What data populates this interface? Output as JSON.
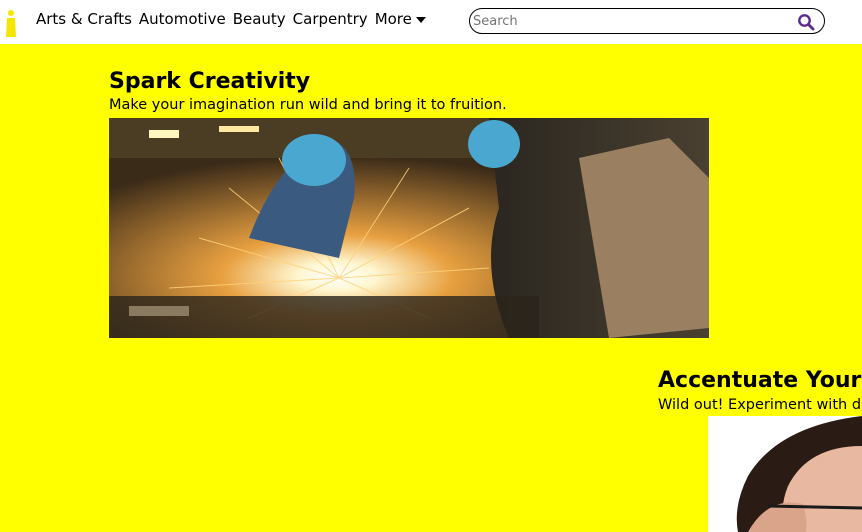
{
  "nav": {
    "items": [
      {
        "label": "Arts & Crafts"
      },
      {
        "label": "Automotive"
      },
      {
        "label": "Beauty"
      },
      {
        "label": "Carpentry"
      }
    ],
    "more_label": "More"
  },
  "search": {
    "placeholder": "Search",
    "icon": "search-icon"
  },
  "colors": {
    "background": "#ffff00",
    "header": "#ffffff",
    "logo": "#f5e600",
    "search_icon": "#5a2a8c"
  },
  "promos": [
    {
      "title": "Spark Creativity",
      "subtitle": "Make your imagination run wild and bring it to fruition."
    },
    {
      "title": "Accentuate Your V",
      "subtitle": "Wild out! Experiment with dif"
    }
  ]
}
